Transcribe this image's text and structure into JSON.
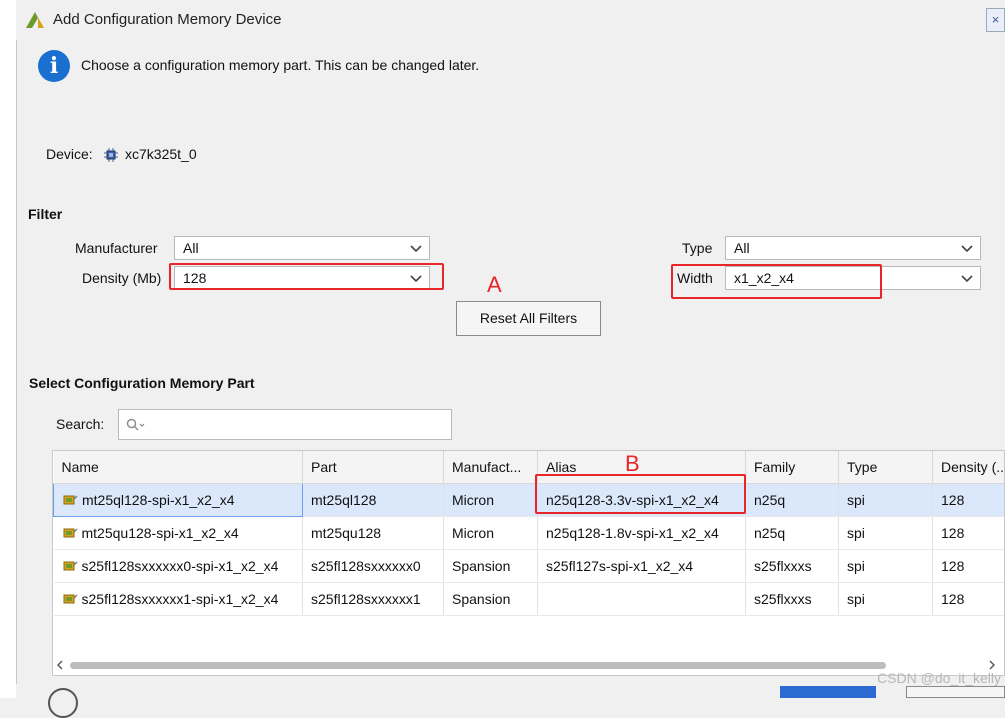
{
  "window": {
    "title": "Add Configuration Memory Device"
  },
  "info": {
    "message": "Choose a configuration memory part. This can be changed later."
  },
  "device": {
    "label": "Device:",
    "value": "xc7k325t_0"
  },
  "filter": {
    "title": "Filter",
    "manufacturer": {
      "label": "Manufacturer",
      "value": "All"
    },
    "density": {
      "label": "Density (Mb)",
      "value": "128"
    },
    "type": {
      "label": "Type",
      "value": "All"
    },
    "width": {
      "label": "Width",
      "value": "x1_x2_x4"
    },
    "reset_label": "Reset All Filters"
  },
  "annotations": {
    "a": "A",
    "b": "B"
  },
  "select_part": {
    "title": "Select Configuration Memory Part",
    "search_label": "Search:",
    "search_placeholder": ""
  },
  "table": {
    "columns": [
      "Name",
      "Part",
      "Manufact...",
      "Alias",
      "Family",
      "Type",
      "Density (..."
    ],
    "rows": [
      [
        "mt25ql128-spi-x1_x2_x4",
        "mt25ql128",
        "Micron",
        "n25q128-3.3v-spi-x1_x2_x4",
        "n25q",
        "spi",
        "128"
      ],
      [
        "mt25qu128-spi-x1_x2_x4",
        "mt25qu128",
        "Micron",
        "n25q128-1.8v-spi-x1_x2_x4",
        "n25q",
        "spi",
        "128"
      ],
      [
        "s25fl128sxxxxxx0-spi-x1_x2_x4",
        "s25fl128sxxxxxx0",
        "Spansion",
        "s25fl127s-spi-x1_x2_x4",
        "s25flxxxs",
        "spi",
        "128"
      ],
      [
        "s25fl128sxxxxxx1-spi-x1_x2_x4",
        "s25fl128sxxxxxx1",
        "Spansion",
        "",
        "s25flxxxs",
        "spi",
        "128"
      ]
    ],
    "selected_row": 0
  },
  "watermark": "CSDN @do_it_kelly",
  "colors": {
    "accent": "#1a6fd1",
    "annotation": "#e8262a",
    "selection": "#dbe8fb"
  }
}
